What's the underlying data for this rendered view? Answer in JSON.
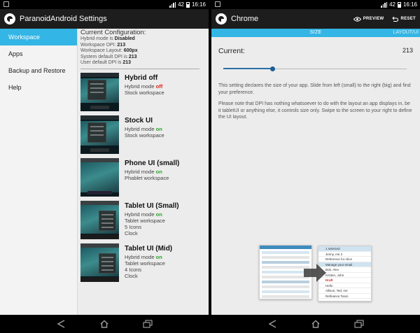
{
  "status": {
    "left_time": "16:16",
    "right_time": "16:16",
    "left_battery": "42",
    "right_battery": "42"
  },
  "left": {
    "title": "ParanoidAndroid Settings",
    "sidebar": [
      {
        "label": "Workspace",
        "active": true
      },
      {
        "label": "Apps",
        "active": false
      },
      {
        "label": "Backup and Restore",
        "active": false
      },
      {
        "label": "Help",
        "active": false
      }
    ],
    "config": {
      "heading": "Current Configuration:",
      "hybrid_label": "Hybrid mode is",
      "hybrid_value": "Disabled",
      "dpi_label": "Workspace DPI:",
      "dpi_value": "213",
      "layout_label": "Workspace Layout:",
      "layout_value": "600px",
      "sys_label": "System default DPI is",
      "sys_value": "213",
      "user_label": "User default DPI is",
      "user_value": "213"
    },
    "modes": [
      {
        "title": "Hybrid off",
        "hybrid_prefix": "Hybrid mode",
        "hybrid_state": "off",
        "line2": "Stock workspace",
        "line3": "",
        "line4": ""
      },
      {
        "title": "Stock UI",
        "hybrid_prefix": "Hybrid mode",
        "hybrid_state": "on",
        "line2": "Stock workspace",
        "line3": "",
        "line4": ""
      },
      {
        "title": "Phone UI (small)",
        "hybrid_prefix": "Hybrid mode",
        "hybrid_state": "on",
        "line2": "Phablet workspace",
        "line3": "",
        "line4": ""
      },
      {
        "title": "Tablet UI (Small)",
        "hybrid_prefix": "Hybrid mode",
        "hybrid_state": "on",
        "line2": "Tablet workspace",
        "line3": "5 Icons",
        "line4": "Clock"
      },
      {
        "title": "Tablet UI (Mid)",
        "hybrid_prefix": "Hybrid mode",
        "hybrid_state": "on",
        "line2": "Tablet workspace",
        "line3": "4 Icons",
        "line4": "Clock"
      }
    ]
  },
  "right": {
    "title": "Chrome",
    "preview_label": "PREVIEW",
    "reset_label": "RESET",
    "tab_size": "SIZE",
    "tab_layout": "LAYOUT/UI",
    "current_label": "Current:",
    "current_value": "213",
    "slider_fraction": 0.27,
    "desc1": "This setting declares the size of your app. Slide from left (small) to the right (big) and find your preference.",
    "desc2": "Please note that DPI has nothing whatsoever to do with the layout an app displays in, be it tabletUI or anything else, it controls size only. Swipe to the screen to your right to define the UI layout.",
    "illustration": {
      "header": "1 selected",
      "lines": [
        "Jenny, me  2",
        "Reference for Alice",
        "Manage your email",
        "Bob, Alex",
        "Kristen, John",
        "Draft",
        "Hello",
        "Allison, Ted, me",
        "Refinance Team"
      ]
    }
  },
  "colors": {
    "accent": "#33b5e5",
    "on": "#28a72c",
    "off": "#e0241b"
  }
}
